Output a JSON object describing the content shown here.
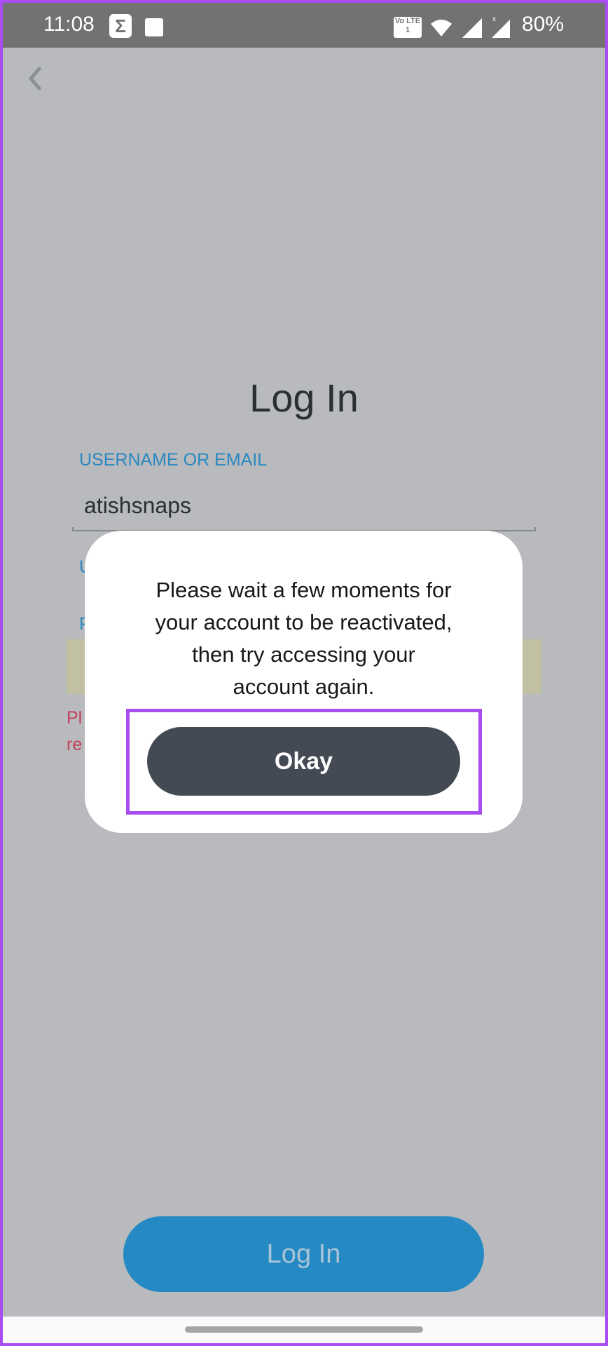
{
  "status_bar": {
    "time": "11:08",
    "battery": "80%",
    "volte": "Vo LTE 1",
    "icons": [
      "sigma-icon",
      "gallery-icon",
      "volte-icon",
      "wifi-icon",
      "signal-icon",
      "signal-x-icon"
    ]
  },
  "header": {
    "back_icon": "chevron-left-icon"
  },
  "form": {
    "title": "Log In",
    "username_label": "USERNAME OR EMAIL",
    "username_value": "atishsnaps",
    "hidden_label_1": "U",
    "password_label": "P",
    "error_line_1": "Pl",
    "error_line_2": "re"
  },
  "dialog": {
    "message_lines": [
      "Please wait a few moments for",
      "your account to be reactivated,",
      "then try accessing your",
      "account again."
    ],
    "okay_label": "Okay"
  },
  "footer": {
    "login_label": "Log In"
  },
  "colors": {
    "accent": "#2589c4",
    "highlight": "#a84df0",
    "dialog_button": "#444a54",
    "error": "#c2425e"
  }
}
